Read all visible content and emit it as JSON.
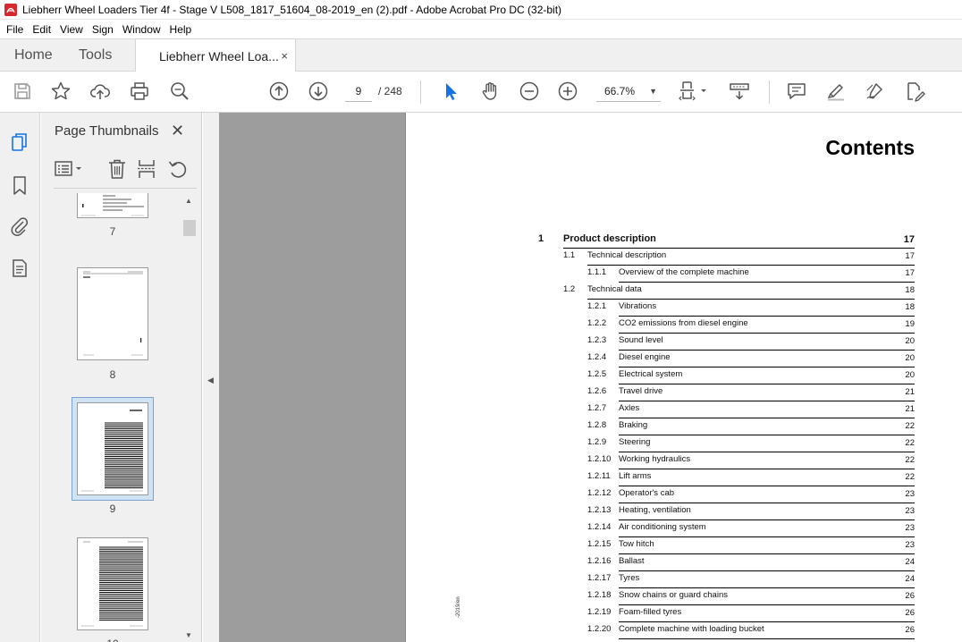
{
  "window": {
    "title": "Liebherr Wheel Loaders Tier 4f - Stage V L508_1817_51604_08-2019_en (2).pdf - Adobe Acrobat Pro DC (32-bit)"
  },
  "menu": [
    "File",
    "Edit",
    "View",
    "Sign",
    "Window",
    "Help"
  ],
  "tabs": {
    "home": "Home",
    "tools": "Tools",
    "document": "Liebherr Wheel Loa...",
    "close": "×"
  },
  "toolbar": {
    "page_current": "9",
    "page_total": "/  248",
    "zoom": "66.7%",
    "zoom_caret": "▼",
    "icons": [
      "save-icon",
      "star-icon",
      "upload-icon",
      "print-icon",
      "find-icon",
      "prev-page-icon",
      "next-page-icon",
      "select-pointer-icon",
      "hand-icon",
      "zoom-out-icon",
      "zoom-in-icon",
      "page-fit-icon",
      "scroll-mode-icon",
      "comment-icon",
      "highlight-icon",
      "sign-icon",
      "fill-sign-icon"
    ],
    "accent_color": "#1473e6"
  },
  "panel": {
    "title": "Page Thumbnails",
    "close": "✕",
    "thumbnails": [
      {
        "label": "7"
      },
      {
        "label": "8"
      },
      {
        "label": "9",
        "selected": true
      },
      {
        "label": "10"
      }
    ]
  },
  "gutter": {
    "collapse_glyph": "◀"
  },
  "document": {
    "heading": "Contents",
    "side_stamp": "-2019/en",
    "toc": [
      {
        "num": "1",
        "text": "Product description",
        "page": "17",
        "level": 1
      },
      {
        "num": "1.1",
        "text": "Technical description",
        "page": "17",
        "level": 2
      },
      {
        "num": "1.1.1",
        "text": "Overview of the complete machine",
        "page": "17",
        "level": 3
      },
      {
        "num": "1.2",
        "text": "Technical data",
        "page": "18",
        "level": 2
      },
      {
        "num": "1.2.1",
        "text": "Vibrations",
        "page": "18",
        "level": 3
      },
      {
        "num": "1.2.2",
        "text": "CO2 emissions from diesel engine",
        "page": "19",
        "level": 3
      },
      {
        "num": "1.2.3",
        "text": "Sound level",
        "page": "20",
        "level": 3
      },
      {
        "num": "1.2.4",
        "text": "Diesel engine",
        "page": "20",
        "level": 3
      },
      {
        "num": "1.2.5",
        "text": "Electrical system",
        "page": "20",
        "level": 3
      },
      {
        "num": "1.2.6",
        "text": "Travel drive",
        "page": "21",
        "level": 3
      },
      {
        "num": "1.2.7",
        "text": "Axles",
        "page": "21",
        "level": 3
      },
      {
        "num": "1.2.8",
        "text": "Braking",
        "page": "22",
        "level": 3
      },
      {
        "num": "1.2.9",
        "text": "Steering",
        "page": "22",
        "level": 3
      },
      {
        "num": "1.2.10",
        "text": "Working hydraulics",
        "page": "22",
        "level": 3
      },
      {
        "num": "1.2.11",
        "text": "Lift arms",
        "page": "22",
        "level": 3
      },
      {
        "num": "1.2.12",
        "text": "Operator's cab",
        "page": "23",
        "level": 3
      },
      {
        "num": "1.2.13",
        "text": "Heating, ventilation",
        "page": "23",
        "level": 3
      },
      {
        "num": "1.2.14",
        "text": "Air conditioning system",
        "page": "23",
        "level": 3
      },
      {
        "num": "1.2.15",
        "text": "Tow hitch",
        "page": "23",
        "level": 3
      },
      {
        "num": "1.2.16",
        "text": "Ballast",
        "page": "24",
        "level": 3
      },
      {
        "num": "1.2.17",
        "text": "Tyres",
        "page": "24",
        "level": 3
      },
      {
        "num": "1.2.18",
        "text": "Snow chains or guard chains",
        "page": "26",
        "level": 3
      },
      {
        "num": "1.2.19",
        "text": "Foam-filled tyres",
        "page": "26",
        "level": 3
      },
      {
        "num": "1.2.20",
        "text": "Complete machine with loading bucket",
        "page": "26",
        "level": 3
      }
    ]
  }
}
